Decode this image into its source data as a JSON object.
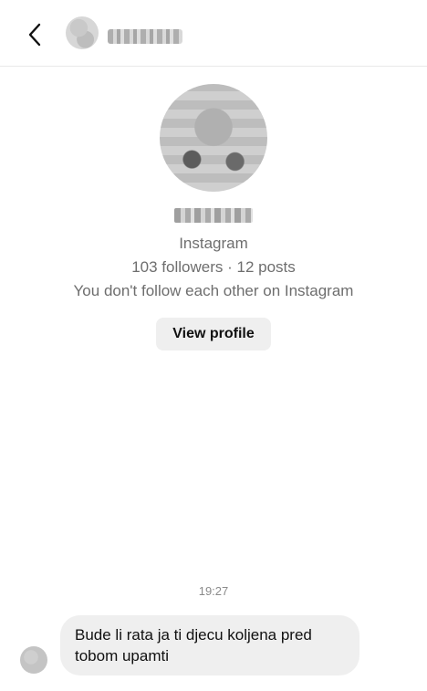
{
  "header": {
    "back_icon": "chevron-left-icon",
    "avatar": "blurred-avatar",
    "name": "blurred-name"
  },
  "profile": {
    "avatar": "blurred-profile-photo",
    "username": "blurred-username",
    "platform": "Instagram",
    "stats": "103 followers · 12 posts",
    "relationship": "You don't follow each other on Instagram",
    "view_profile_label": "View profile"
  },
  "conversation": {
    "timestamp": "19:27",
    "messages": [
      {
        "direction": "incoming",
        "text": "Bude li rata ja ti djecu koljena pred tobom upamti"
      }
    ]
  }
}
